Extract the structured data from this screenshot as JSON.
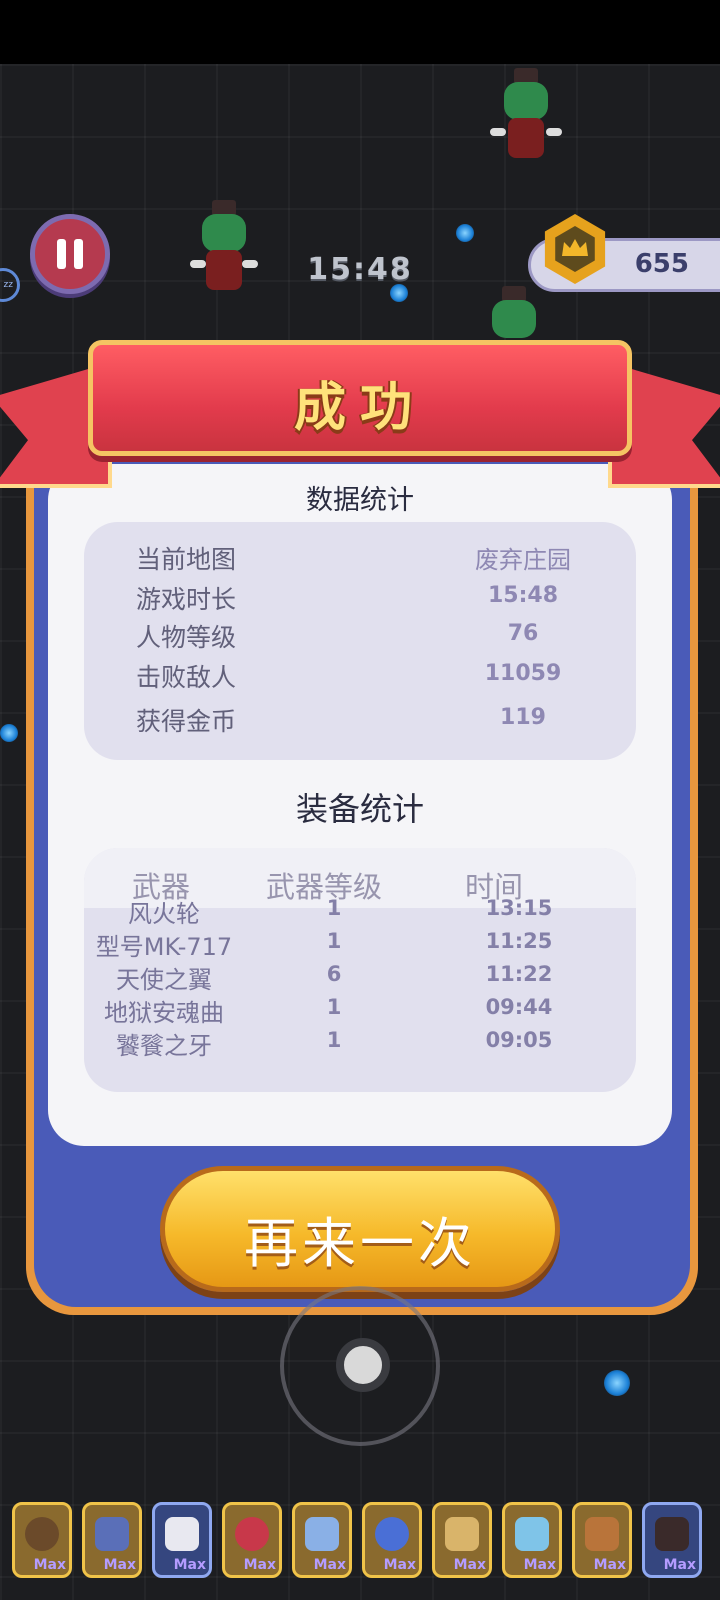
{
  "hud": {
    "timer": "15:48",
    "coins": "655",
    "sleep_badge": "zz"
  },
  "dialog": {
    "title": "成功",
    "stats_title": "数据统计",
    "stats": [
      {
        "label": "当前地图",
        "value": "废弃庄园"
      },
      {
        "label": "游戏时长",
        "value": "15:48"
      },
      {
        "label": "人物等级",
        "value": "76"
      },
      {
        "label": "击败敌人",
        "value": "11059"
      },
      {
        "label": "获得金币",
        "value": "119"
      }
    ],
    "equip_title": "装备统计",
    "equip_headers": {
      "weapon": "武器",
      "level": "武器等级",
      "time": "时间"
    },
    "equipment": [
      {
        "weapon": "风火轮",
        "level": "1",
        "time": "13:15"
      },
      {
        "weapon": "型号MK-717",
        "level": "1",
        "time": "11:25"
      },
      {
        "weapon": "天使之翼",
        "level": "6",
        "time": "11:22"
      },
      {
        "weapon": "地狱安魂曲",
        "level": "1",
        "time": "09:44"
      },
      {
        "weapon": "饕餮之牙",
        "level": "1",
        "time": "09:05"
      }
    ],
    "retry_label": "再来一次"
  },
  "inventory": {
    "slots": [
      {
        "icon": "gear-wheel-icon",
        "badge": "Max",
        "frame": "gold"
      },
      {
        "icon": "blaster-gun-icon",
        "badge": "Max",
        "frame": "gold"
      },
      {
        "icon": "angel-wings-icon",
        "badge": "Max",
        "frame": "blue"
      },
      {
        "icon": "spiral-ring-icon",
        "badge": "Max",
        "frame": "gold"
      },
      {
        "icon": "fang-jar-icon",
        "badge": "Max",
        "frame": "gold"
      },
      {
        "icon": "magic-wand-icon",
        "badge": "Max",
        "frame": "gold"
      },
      {
        "icon": "scroll-icon",
        "badge": "Max",
        "frame": "gold"
      },
      {
        "icon": "staff-icon",
        "badge": "Max",
        "frame": "gold"
      },
      {
        "icon": "fist-glove-icon",
        "badge": "Max",
        "frame": "gold"
      },
      {
        "icon": "demon-wings-icon",
        "badge": "Max",
        "frame": "blue"
      }
    ]
  },
  "colors": {
    "banner_red": "#e23b4c",
    "panel_blue": "#4a5bb8",
    "button_gold": "#f6b92a",
    "value_purple": "#8e88b3"
  }
}
